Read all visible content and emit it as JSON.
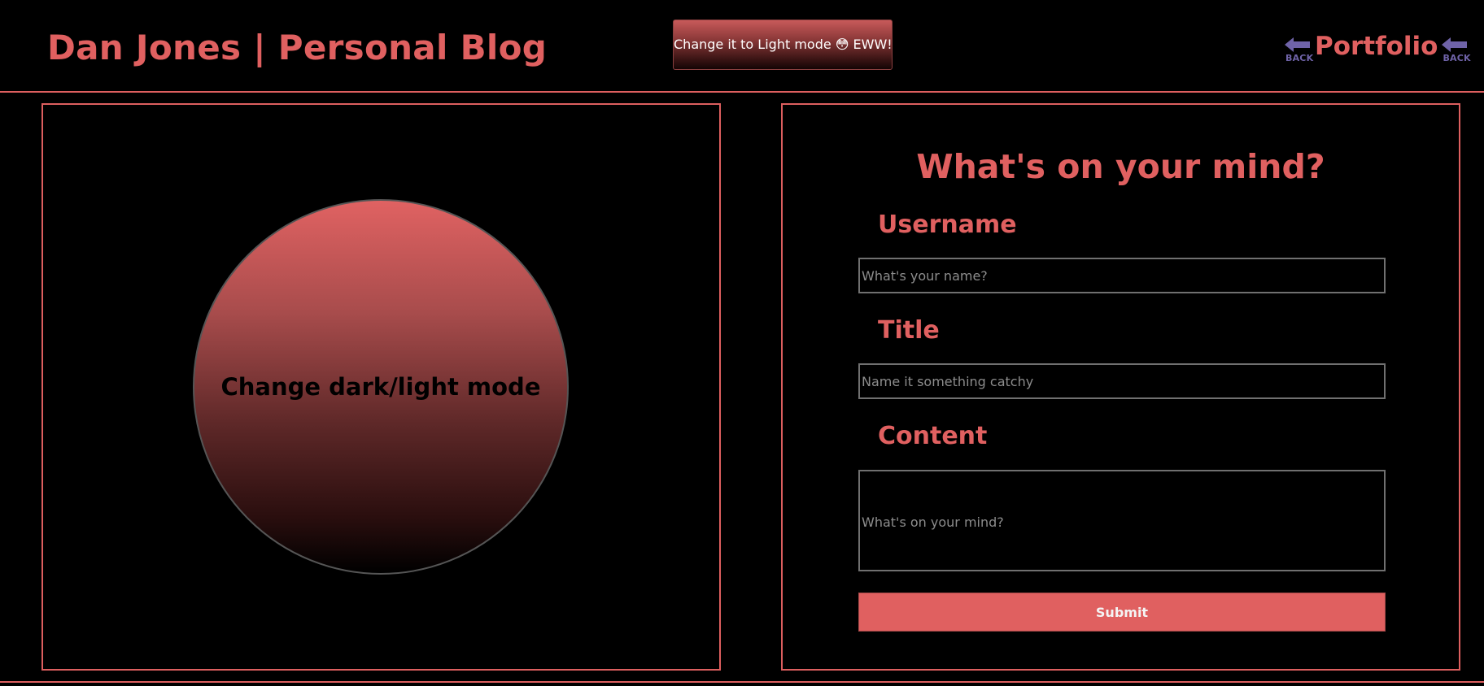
{
  "header": {
    "title": "Dan Jones | Personal Blog",
    "mode_button_label": "Change it to Light mode 😳 EWW!",
    "portfolio_label": "Portfolio",
    "back_icon_text": "BACK"
  },
  "left_panel": {
    "circle_label": "Change dark/light mode"
  },
  "form": {
    "heading": "What's on your mind?",
    "username_label": "Username",
    "username_placeholder": "What's your name?",
    "username_value": "",
    "title_label": "Title",
    "title_placeholder": "Name it something catchy",
    "title_value": "",
    "content_label": "Content",
    "content_placeholder": "What's on your mind?",
    "content_value": "",
    "submit_label": "Submit"
  },
  "icons": {
    "back_left": "back-arrow-icon",
    "back_right": "back-arrow-icon"
  },
  "colors": {
    "accent": "#e06060",
    "background": "#000000",
    "back_icon": "#6f63a8",
    "input_border": "#707070"
  }
}
